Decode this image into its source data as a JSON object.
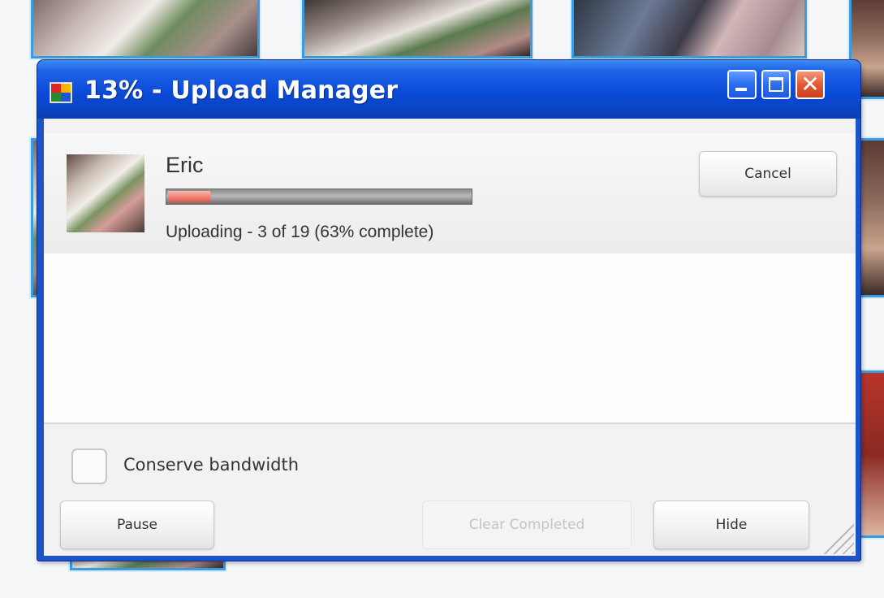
{
  "window": {
    "title": "13% - Upload Manager",
    "icon": "picasa-icon",
    "controls": {
      "minimize": "minimize-icon",
      "maximize": "maximize-icon",
      "close": "close-icon"
    },
    "accent_color": "#0a44c8",
    "close_color": "#e35a35"
  },
  "upload": {
    "album_name": "Eric",
    "status": "Uploading - 3 of 19 (63% complete)",
    "current_file_progress": 0.14,
    "cancel_label": "Cancel"
  },
  "options": {
    "conserve_bandwidth_label": "Conserve bandwidth",
    "conserve_bandwidth_checked": false
  },
  "footer": {
    "pause_label": "Pause",
    "clear_completed_label": "Clear Completed",
    "hide_label": "Hide"
  }
}
